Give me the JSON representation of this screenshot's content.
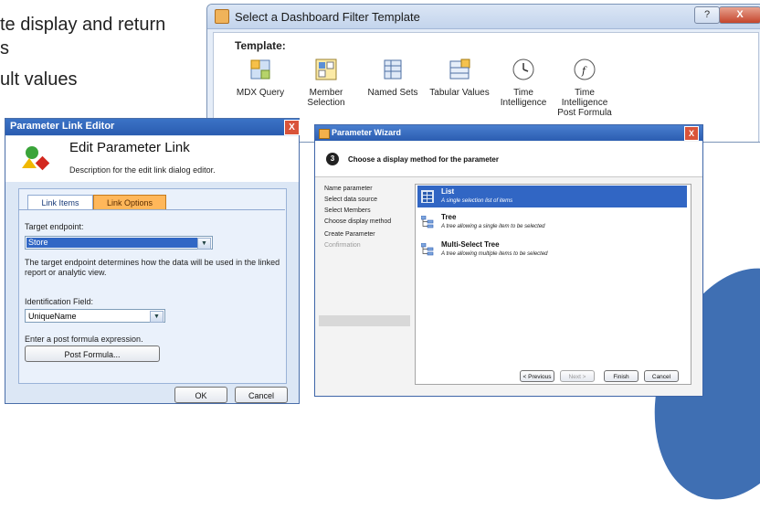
{
  "slide": {
    "bullets": [
      "te display and return",
      "s",
      "ult values"
    ]
  },
  "template_dialog": {
    "title": "Select a Dashboard Filter Template",
    "help_label": "?",
    "close_label": "X",
    "template_label": "Template:",
    "templates": [
      {
        "label": "MDX Query",
        "icon": "mdx-query-icon"
      },
      {
        "label": "Member Selection",
        "icon": "member-selection-icon"
      },
      {
        "label": "Named Sets",
        "icon": "named-sets-icon"
      },
      {
        "label": "Tabular Values",
        "icon": "tabular-values-icon"
      },
      {
        "label": "Time Intelligence",
        "icon": "clock-icon"
      },
      {
        "label": "Time Intelligence Post Formula",
        "icon": "clock-formula-icon"
      }
    ]
  },
  "link_editor": {
    "title": "Parameter Link Editor",
    "close_label": "X",
    "heading": "Edit Parameter Link",
    "description": "Description for the edit link dialog editor.",
    "tabs": [
      "Link Items",
      "Link Options"
    ],
    "active_tab": "Link Options",
    "target_endpoint_label": "Target endpoint:",
    "target_endpoint_value": "Store",
    "target_help": "The target endpoint determines how the data will be used in the linked report or analytic view.",
    "id_field_label": "Identification Field:",
    "id_field_value": "UniqueName",
    "post_formula_prompt": "Enter a post formula expression.",
    "post_formula_button": "Post Formula...",
    "ok_label": "OK",
    "cancel_label": "Cancel"
  },
  "wizard": {
    "title": "Parameter Wizard",
    "close_label": "X",
    "step_number": "3",
    "heading": "Choose a display method for the parameter",
    "steps": [
      {
        "label": "Name parameter",
        "state": "done"
      },
      {
        "label": "Select data source",
        "state": "done"
      },
      {
        "label": "Select Members",
        "state": "done"
      },
      {
        "label": "Choose display method",
        "state": "current"
      },
      {
        "label": "Create Parameter",
        "state": "todo"
      },
      {
        "label": "Confirmation",
        "state": "todo"
      }
    ],
    "options": [
      {
        "title": "List",
        "desc": "A single selection list of items",
        "selected": true
      },
      {
        "title": "Tree",
        "desc": "A tree allowing a single item to be selected",
        "selected": false
      },
      {
        "title": "Multi-Select Tree",
        "desc": "A tree allowing multiple items to be selected",
        "selected": false
      }
    ],
    "buttons": {
      "previous": "< Previous",
      "next": "Next >",
      "finish": "Finish",
      "cancel": "Cancel"
    }
  },
  "colors": {
    "accent_blue": "#3166c4",
    "tab_orange": "#ffb75a",
    "title_blue": "#2a5cb0"
  }
}
